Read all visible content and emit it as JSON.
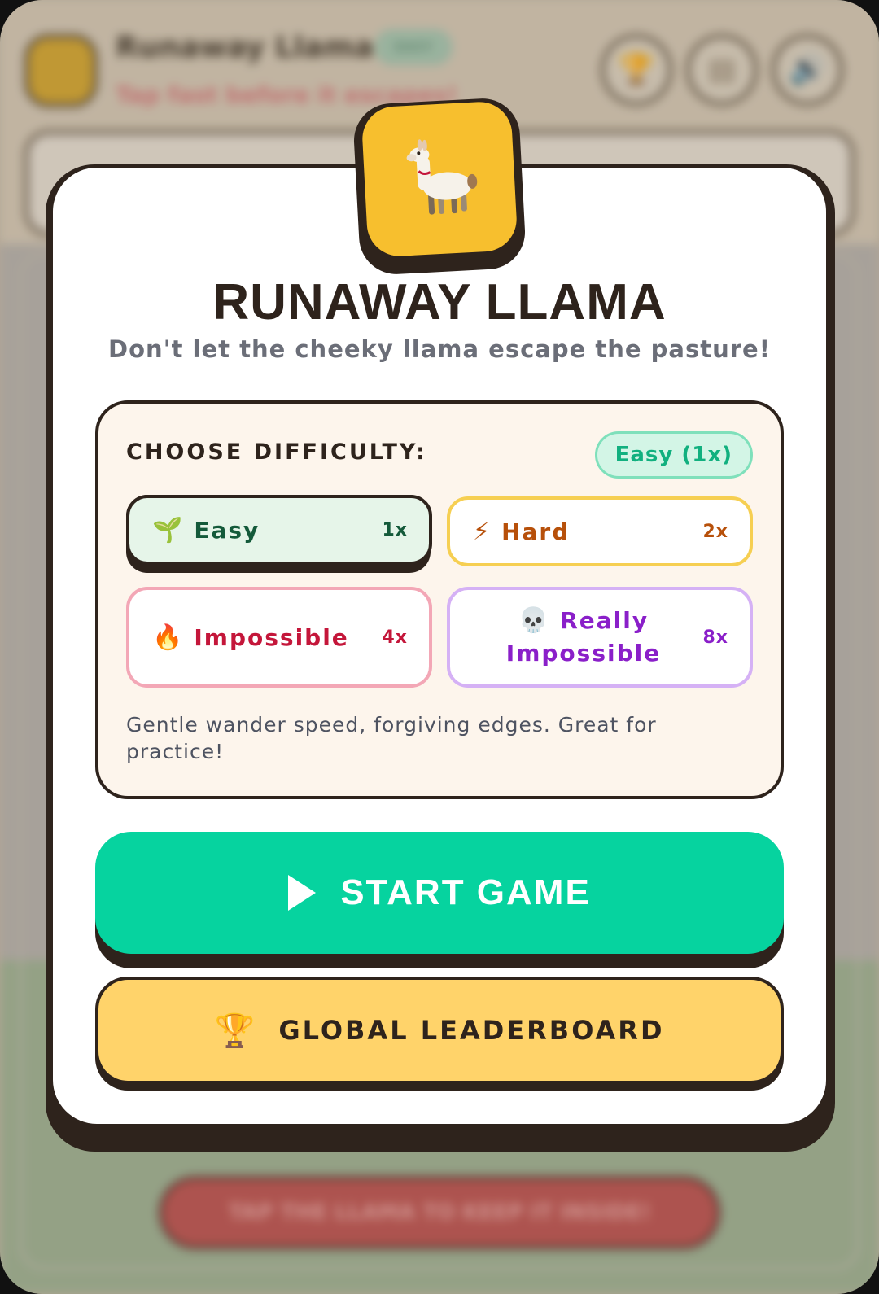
{
  "background": {
    "game_title": "Runaway Llama",
    "badge": "EASY",
    "subtitle": "Tap fast before it escapes!",
    "tap_hint": "TAP THE LLAMA TO KEEP IT INSIDE!"
  },
  "modal": {
    "logo_emoji": "llama",
    "title": "RUNAWAY LLAMA",
    "subtitle": "Don't let the cheeky llama escape the pasture!"
  },
  "difficulty": {
    "heading": "CHOOSE DIFFICULTY:",
    "selected_label": "Easy (1x)",
    "options": [
      {
        "emoji": "🌱",
        "label": "Easy",
        "multiplier": "1x",
        "selected": true
      },
      {
        "emoji": "⚡",
        "label": "Hard",
        "multiplier": "2x",
        "selected": false
      },
      {
        "emoji": "🔥",
        "label": "Impossible",
        "multiplier": "4x",
        "selected": false
      },
      {
        "emoji": "💀",
        "label_line1": "Really",
        "label_line2": "Impossible",
        "multiplier": "8x",
        "selected": false
      }
    ],
    "description": "Gentle wander speed, forgiving edges. Great for practice!"
  },
  "buttons": {
    "start": "START GAME",
    "leaderboard_emoji": "🏆",
    "leaderboard": "GLOBAL LEADERBOARD"
  },
  "colors": {
    "start": "#06d39f",
    "leaderboard": "#ffd36a",
    "logo": "#f7bf2e",
    "outline": "#2e231c"
  }
}
